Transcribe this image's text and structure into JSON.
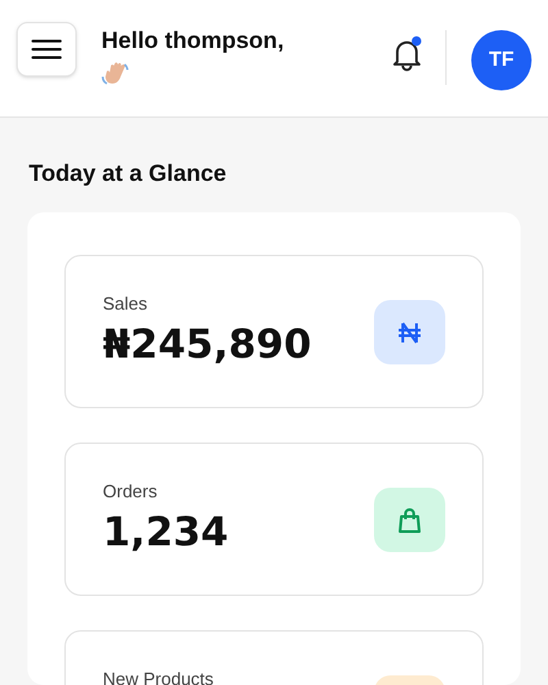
{
  "header": {
    "greeting": "Hello thompson,",
    "notifications": {
      "unread": true
    },
    "avatar": {
      "initials": "TF"
    }
  },
  "section_title": "Today at a Glance",
  "stats": [
    {
      "label": "Sales",
      "value": "₦245,890",
      "kind": "sales",
      "color": "#dbe8fe"
    },
    {
      "label": "Orders",
      "value": "1,234",
      "kind": "orders",
      "color": "#d2f7e4"
    },
    {
      "label": "New Products",
      "kind": "products",
      "color": "#feebd0"
    }
  ]
}
